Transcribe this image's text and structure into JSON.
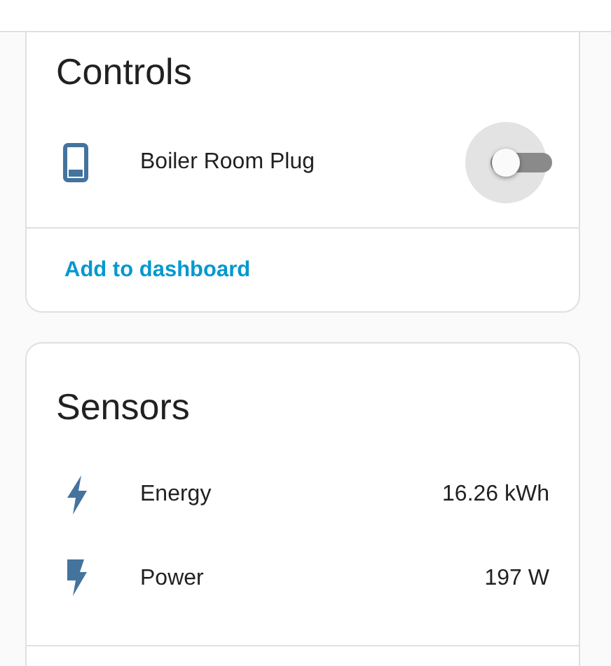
{
  "controls": {
    "title": "Controls",
    "items": [
      {
        "name": "Boiler Room Plug",
        "on": false
      }
    ],
    "link": "Add to dashboard"
  },
  "sensors": {
    "title": "Sensors",
    "items": [
      {
        "kind": "energy",
        "name": "Energy",
        "value": "16.26 kWh"
      },
      {
        "kind": "power",
        "name": "Power",
        "value": "197 W"
      }
    ]
  }
}
